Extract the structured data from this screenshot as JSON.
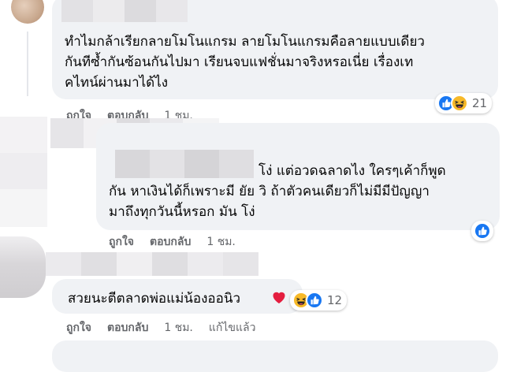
{
  "comments": [
    {
      "text": "ทำไมกล้าเรียกลายโมโนแกรม ลายโมโนแกรมคือลายแบบเดียว\nกันทีซ้ำกันซ้อนกันไปมา เรียนจบแฟชั่นมาจริงหรอเนี่ย เรื่องเท\nคไทน์ผ่านมาได้ไง",
      "like_label": "ถูกใจ",
      "reply_label": "ตอบกลับ",
      "time": "1 ชม.",
      "reaction_count": "21",
      "reaction_icons": [
        "like-icon",
        "haha-icon"
      ]
    },
    {
      "text": "โง่ แต่อวดฉลาดไง ใครๆเค้าก็พูด\nกัน หาเงินได้ก็เพราะมี ยัย วิ ถ้าตัวคนเดียวก็ไม่มีมีปัญญา\nมาถึงทุกวันนี้หรอก มัน โง่",
      "like_label": "ถูกใจ",
      "reply_label": "ตอบกลับ",
      "time": "1 ชม.",
      "reaction_icons": [
        "like-icon"
      ]
    },
    {
      "text": "สวยนะตีตลาดพ่อแม่น้องออนิว",
      "like_label": "ถูกใจ",
      "reply_label": "ตอบกลับ",
      "time": "1 ชม.",
      "edited_label": "แก้ไขแล้ว",
      "reaction_count": "12",
      "reaction_icons": [
        "haha-icon",
        "like-icon"
      ]
    }
  ],
  "colors": {
    "bubble": "#f0f2f5",
    "secondary_text": "#65676b",
    "like_blue": "#1877f2",
    "haha_yellow": "#f7b928",
    "heart_red": "#e41e3f"
  }
}
